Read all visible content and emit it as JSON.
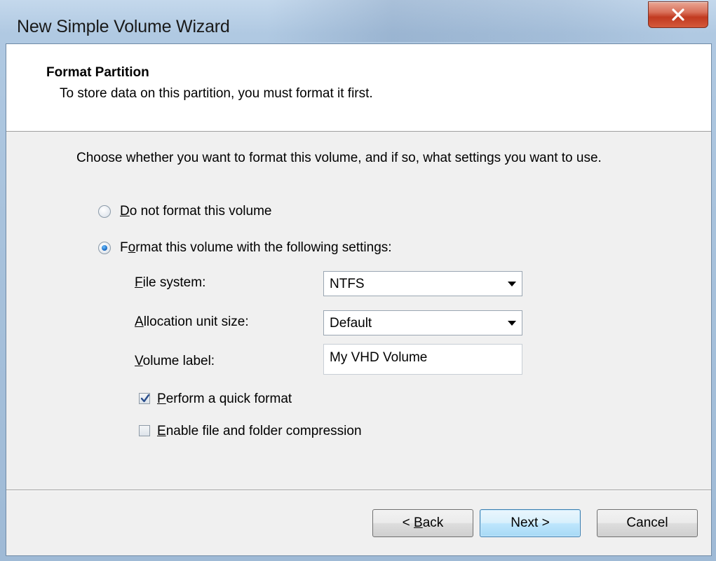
{
  "window": {
    "title": "New Simple Volume Wizard",
    "close_symbol": "x"
  },
  "header": {
    "title": "Format Partition",
    "subtitle": "To store data on this partition, you must format it first."
  },
  "instruction": "Choose whether you want to format this volume, and if so, what settings you want to use.",
  "options": {
    "do_not_format": {
      "mnemonic": "D",
      "rest": "o not format this volume",
      "selected": false
    },
    "format_with": {
      "pre": "F",
      "mnemonic": "o",
      "rest": "rmat this volume with the following settings:",
      "selected": true
    }
  },
  "settings": {
    "file_system": {
      "mnemonic": "F",
      "rest": "ile system:",
      "value": "NTFS"
    },
    "allocation_unit_size": {
      "mnemonic": "A",
      "rest": "llocation unit size:",
      "value": "Default"
    },
    "volume_label": {
      "mnemonic": "V",
      "rest": "olume label:",
      "value": "My VHD Volume"
    },
    "quick_format": {
      "mnemonic": "P",
      "rest": "erform a quick format",
      "checked": true
    },
    "compression": {
      "mnemonic": "E",
      "rest": "nable file and folder compression",
      "checked": false
    }
  },
  "buttons": {
    "back": {
      "pre": "< ",
      "mnemonic": "B",
      "rest": "ack"
    },
    "next": "Next >",
    "cancel": "Cancel"
  },
  "colors": {
    "accent": "#3c7fb1",
    "close_button": "#c13a20",
    "dialog_background": "#f0f0f0"
  }
}
